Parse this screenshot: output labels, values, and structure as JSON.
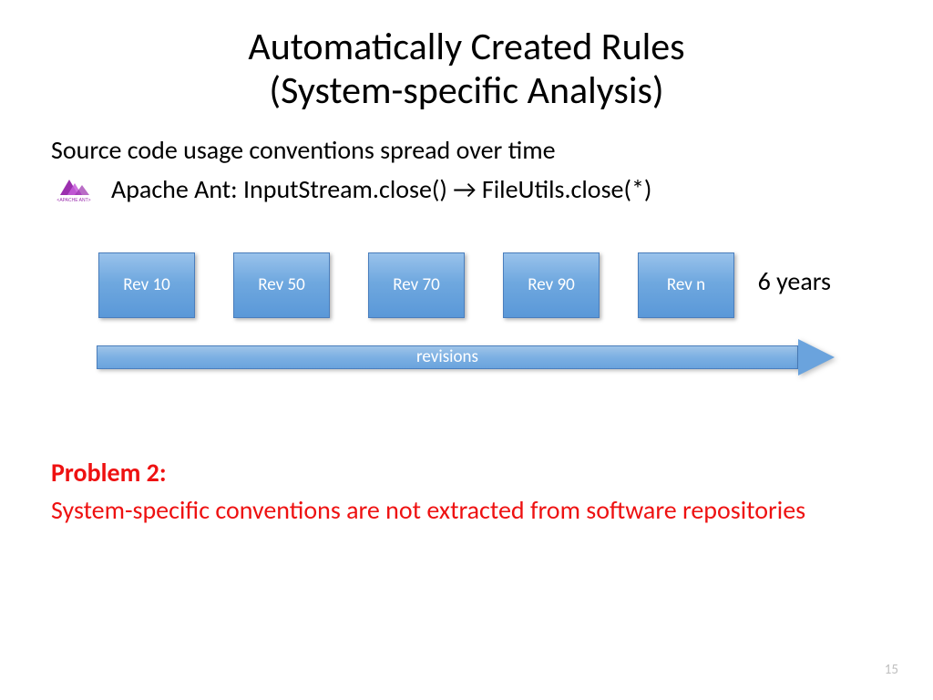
{
  "title_line1": "Automatically Created Rules",
  "title_line2": "(System-specific Analysis)",
  "subtitle": "Source code usage conventions spread over time",
  "example": "Apache Ant: InputStream.close() → FileUtils.close(*)",
  "revisions": [
    "Rev 10",
    "Rev 50",
    "Rev 70",
    "Rev 90",
    "Rev n"
  ],
  "years_label": "6 years",
  "arrow_label": "revisions",
  "problem_heading": "Problem 2:",
  "problem_text": "System-specific conventions are not extracted from software repositories",
  "page_number": "15"
}
